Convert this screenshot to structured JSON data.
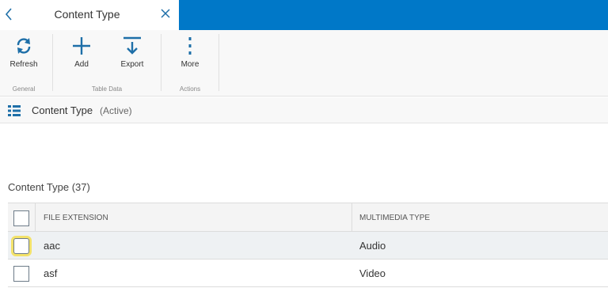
{
  "tab": {
    "title": "Content Type"
  },
  "ribbon": {
    "refresh_label": "Refresh",
    "add_label": "Add",
    "export_label": "Export",
    "more_label": "More",
    "groups": {
      "general": "General",
      "table_data": "Table Data",
      "actions": "Actions"
    }
  },
  "header": {
    "title": "Content Type",
    "status": "(Active)"
  },
  "section": {
    "title": "Content Type (37)"
  },
  "table": {
    "columns": [
      "FILE EXTENSION",
      "MULTIMEDIA TYPE"
    ],
    "rows": [
      {
        "extension": "aac",
        "type": "Audio"
      },
      {
        "extension": "asf",
        "type": "Video"
      }
    ]
  },
  "colors": {
    "accent": "#0078c8",
    "icon_blue": "#1e6fa8",
    "focus": "#f3e26a"
  }
}
